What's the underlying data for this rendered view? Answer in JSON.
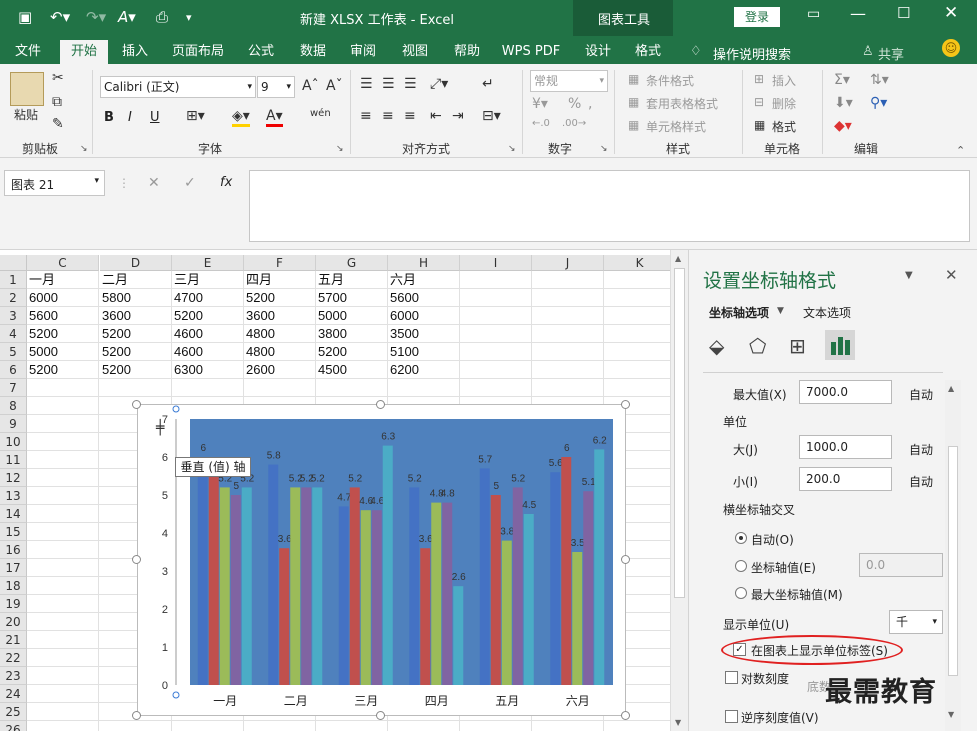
{
  "window": {
    "title": "新建 XLSX 工作表 - Excel",
    "context_tab": "图表工具",
    "login_label": "登录"
  },
  "tabs": [
    "文件",
    "开始",
    "插入",
    "页面布局",
    "公式",
    "数据",
    "审阅",
    "视图",
    "帮助",
    "WPS PDF",
    "设计",
    "格式"
  ],
  "tell_me": "操作说明搜索",
  "share_label": "共享",
  "ribbon": {
    "paste_label": "粘贴",
    "groups": [
      "剪贴板",
      "字体",
      "对齐方式",
      "数字",
      "样式",
      "单元格",
      "编辑"
    ],
    "font_name": "Calibri (正文)",
    "font_size": "9",
    "number_format": "常规",
    "styles_items": [
      "条件格式",
      "套用表格格式",
      "单元格样式"
    ],
    "cells_items": [
      "插入",
      "删除",
      "格式"
    ],
    "bold": "B",
    "italic": "I",
    "underline": "U"
  },
  "formula_bar": {
    "name_box": "图表 21",
    "fx": "fx"
  },
  "sheet": {
    "columns": [
      "C",
      "D",
      "E",
      "F",
      "G",
      "H",
      "I",
      "J",
      "K"
    ],
    "rows": [
      "1",
      "2",
      "3",
      "4",
      "5",
      "6",
      "7",
      "8",
      "9",
      "10",
      "11",
      "12",
      "13",
      "14",
      "15",
      "16",
      "17",
      "18",
      "19",
      "20",
      "21",
      "22",
      "23",
      "24",
      "25",
      "26"
    ],
    "cells": [
      [
        "一月",
        "二月",
        "三月",
        "四月",
        "五月",
        "六月"
      ],
      [
        "6000",
        "5800",
        "4700",
        "5200",
        "5700",
        "5600"
      ],
      [
        "5600",
        "3600",
        "5200",
        "3600",
        "5000",
        "6000"
      ],
      [
        "5200",
        "5200",
        "4600",
        "4800",
        "3800",
        "3500"
      ],
      [
        "5000",
        "5200",
        "4600",
        "4800",
        "5200",
        "5100"
      ],
      [
        "5200",
        "5200",
        "6300",
        "2600",
        "4500",
        "6200"
      ]
    ]
  },
  "tooltip": "垂直 (值) 轴",
  "chart_data": {
    "type": "bar",
    "categories": [
      "一月",
      "二月",
      "三月",
      "四月",
      "五月",
      "六月"
    ],
    "series": [
      {
        "values": [
          6,
          5.8,
          4.7,
          5.2,
          5.7,
          5.6
        ],
        "color": "#4472c4"
      },
      {
        "values": [
          5.6,
          3.6,
          5.2,
          3.6,
          5,
          6
        ],
        "color": "#c0504d"
      },
      {
        "values": [
          5.2,
          5.2,
          4.6,
          4.8,
          3.8,
          3.5
        ],
        "color": "#9bbb59"
      },
      {
        "values": [
          5,
          5.2,
          4.6,
          4.8,
          5.2,
          5.1
        ],
        "color": "#8064a2"
      },
      {
        "values": [
          5.2,
          5.2,
          6.3,
          2.6,
          4.5,
          6.2
        ],
        "color": "#4bacc6"
      }
    ],
    "y_ticks": [
      "0",
      "1",
      "2",
      "3",
      "4",
      "5",
      "6",
      "7"
    ],
    "ylim": [
      0,
      7
    ],
    "plot_background": "#4f81bd"
  },
  "panel": {
    "title": "设置坐标轴格式",
    "tab_axis_options": "坐标轴选项",
    "tab_text_options": "文本选项",
    "max_label": "最大值(X)",
    "max_value": "7000.0",
    "auto": "自动",
    "unit_label": "单位",
    "major_label": "大(J)",
    "major_value": "1000.0",
    "minor_label": "小(I)",
    "minor_value": "200.0",
    "cross_label": "横坐标轴交叉",
    "cross_auto": "自动(O)",
    "cross_value_label": "坐标轴值(E)",
    "cross_value": "0.0",
    "cross_max": "最大坐标轴值(M)",
    "display_units_label": "显示单位(U)",
    "display_units_value": "千",
    "show_units_label": "在图表上显示单位标签(S)",
    "log_scale": "对数刻度",
    "base_label": "底数",
    "reverse": "逆序刻度值(V)"
  },
  "watermark": "最需教育"
}
